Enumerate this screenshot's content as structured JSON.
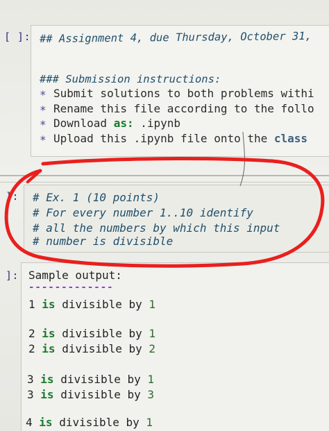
{
  "cell1": {
    "prompt": "[ ]:",
    "title": "## Assignment 4, due Thursday, October 31,",
    "heading": "### Submission instructions:",
    "bullets": [
      {
        "marker": "*",
        "pre": "Submit solutions to both problems withi",
        "bold": "",
        "post": ""
      },
      {
        "marker": "*",
        "pre": "Rename this file according to the follo",
        "bold": "",
        "post": ""
      },
      {
        "marker": "*",
        "pre": "Download ",
        "bold": "as:",
        "post": " .ipynb"
      },
      {
        "marker": "*",
        "pre": "Upload this .ipynb file onto the ",
        "bold": "class",
        "post": ""
      }
    ]
  },
  "cell2": {
    "prompt": "]:",
    "lines": [
      "# Ex. 1 (10 points)",
      "# For every number 1..10 identify",
      "# all the numbers by which this input",
      "# number is divisible"
    ]
  },
  "cell3": {
    "prompt": "]:",
    "header": "Sample output:",
    "rows": [
      {
        "a": "1",
        "is": "is",
        "mid": "divisible by",
        "b": "1"
      },
      {
        "a": "2",
        "is": "is",
        "mid": "divisible by",
        "b": "1"
      },
      {
        "a": "2",
        "is": "is",
        "mid": "divisible by",
        "b": "2"
      },
      {
        "a": "3",
        "is": "is",
        "mid": "divisible by",
        "b": "1"
      },
      {
        "a": "3",
        "is": "is",
        "mid": "divisible by",
        "b": "3"
      },
      {
        "a": "4",
        "is": "is",
        "mid": "divisible by",
        "b": "1"
      }
    ]
  },
  "colors": {
    "annotation": "#e8201e",
    "prompt": "#30307a",
    "keyword": "#1a7a2e",
    "dashes": "#9c3bd0"
  }
}
